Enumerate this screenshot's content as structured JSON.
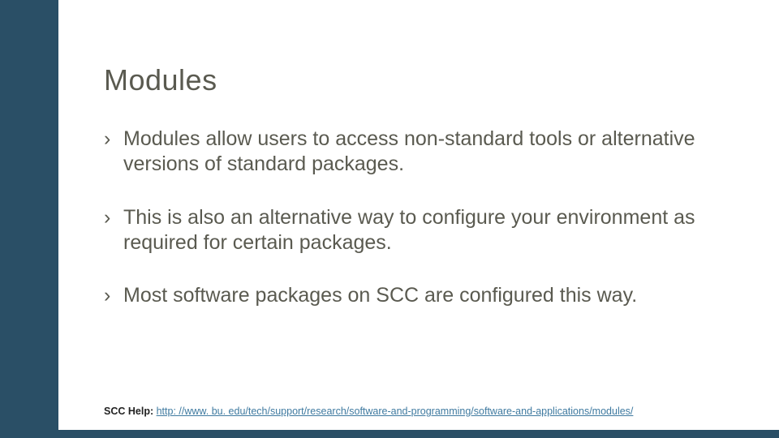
{
  "title": "Modules",
  "bullets": [
    "Modules allow users to access non-standard tools or alternative versions of standard packages.",
    "This is also an alternative way to configure your environment as required for certain packages.",
    "Most software packages on SCC are configured this way."
  ],
  "footer": {
    "label": "SCC Help:",
    "link_text": "http: //www. bu. edu/tech/support/research/software-and-programming/software-and-applications/modules/"
  },
  "colors": {
    "accent": "#2a4f66",
    "text": "#5a5a50",
    "link": "#3f7aa0"
  }
}
